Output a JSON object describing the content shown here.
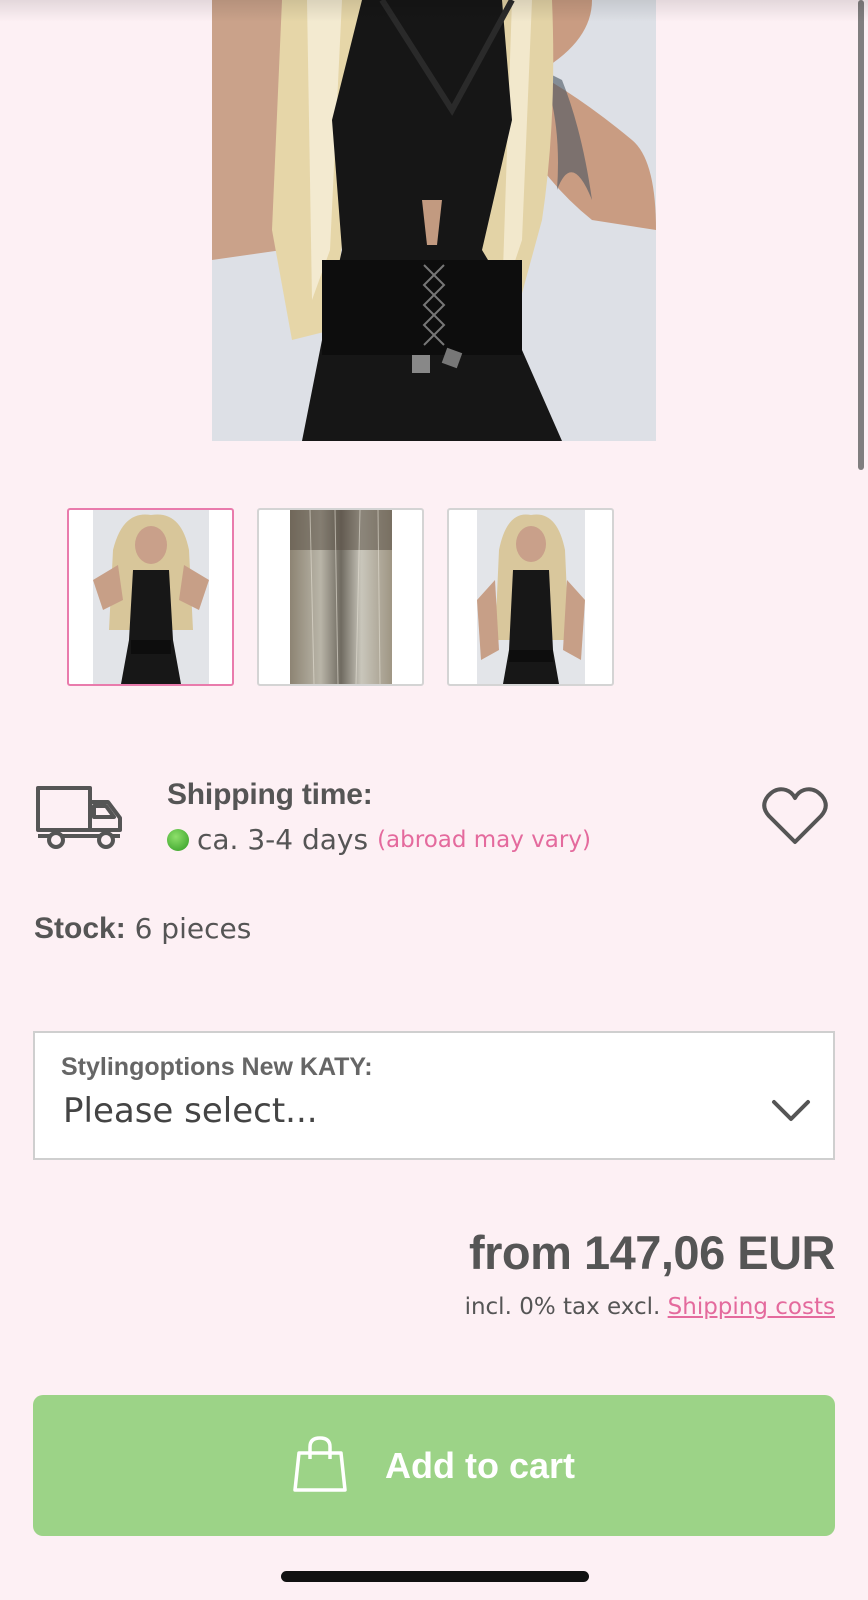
{
  "product": {
    "image_alt": "person in black halter outfit with long blonde wig",
    "thumbnails": [
      {
        "alt": "full front view of wig model",
        "active": true
      },
      {
        "alt": "close-up of wig hair texture",
        "active": false
      },
      {
        "alt": "front view of wig model, hand on hip",
        "active": false
      }
    ]
  },
  "shipping": {
    "label": "Shipping time:",
    "days": "ca. 3-4 days",
    "note": "(abroad may vary)",
    "status_color": "#3dab2c"
  },
  "stock": {
    "label": "Stock:",
    "value": "6 pieces"
  },
  "styling_select": {
    "label": "Stylingoptions New KATY:",
    "value": "Please select..."
  },
  "price": {
    "text": "from 147,06 EUR",
    "tax_text": "incl. 0% tax excl.",
    "shipping_link": "Shipping costs"
  },
  "cart": {
    "label": "Add to cart",
    "color": "#9cd387"
  },
  "colors": {
    "background": "#fdf0f4",
    "accent_pink": "#e46a9d"
  }
}
